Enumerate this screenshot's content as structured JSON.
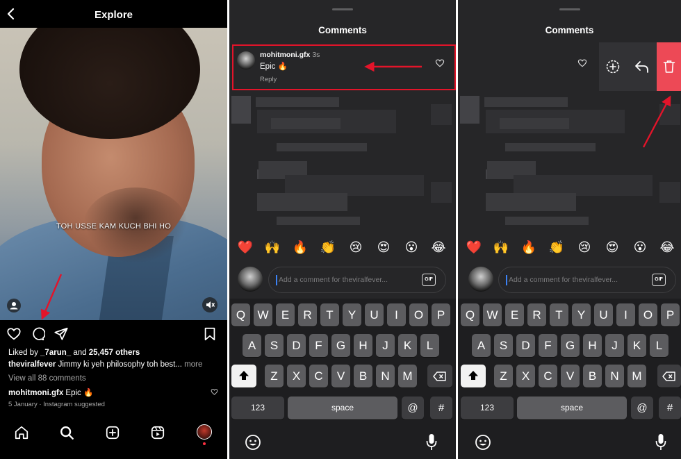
{
  "explore": {
    "title": "Explore",
    "caption_overlay": "TOH USSE KAM KUCH BHI HO",
    "liked_by_prefix": "Liked by ",
    "liked_by_user": "_7arun_",
    "liked_by_mid": " and ",
    "likes_count": "25,457 others",
    "post_user": "theviralfever",
    "post_caption": " Jimmy ki yeh philosophy toh best...",
    "more_label": "more",
    "view_comments": "View all 88 comments",
    "comment_user": "mohitmoni.gfx",
    "comment_text": " Epic 🔥",
    "post_meta": "5 January · Instagram suggested"
  },
  "comments_sheet": {
    "title": "Comments",
    "comment": {
      "user": "mohitmoni.gfx",
      "time": "3s",
      "text": "Epic 🔥",
      "reply_label": "Reply"
    },
    "emojis": [
      "❤️",
      "🙌",
      "🔥",
      "👏",
      "😢",
      "😍",
      "😮",
      "😂"
    ],
    "input_placeholder": "Add a comment for theviralfever...",
    "gif_label": "GIF"
  },
  "keyboard": {
    "row1": [
      "Q",
      "W",
      "E",
      "R",
      "T",
      "Y",
      "U",
      "I",
      "O",
      "P"
    ],
    "row2": [
      "A",
      "S",
      "D",
      "F",
      "G",
      "H",
      "J",
      "K",
      "L"
    ],
    "row3": [
      "Z",
      "X",
      "C",
      "V",
      "B",
      "N",
      "M"
    ],
    "numbers_label": "123",
    "space_label": "space",
    "at_label": "@",
    "hash_label": "#"
  },
  "colors": {
    "annotation_red": "#e3142a",
    "delete_red": "#ed4956",
    "sheet_bg": "#262628"
  }
}
